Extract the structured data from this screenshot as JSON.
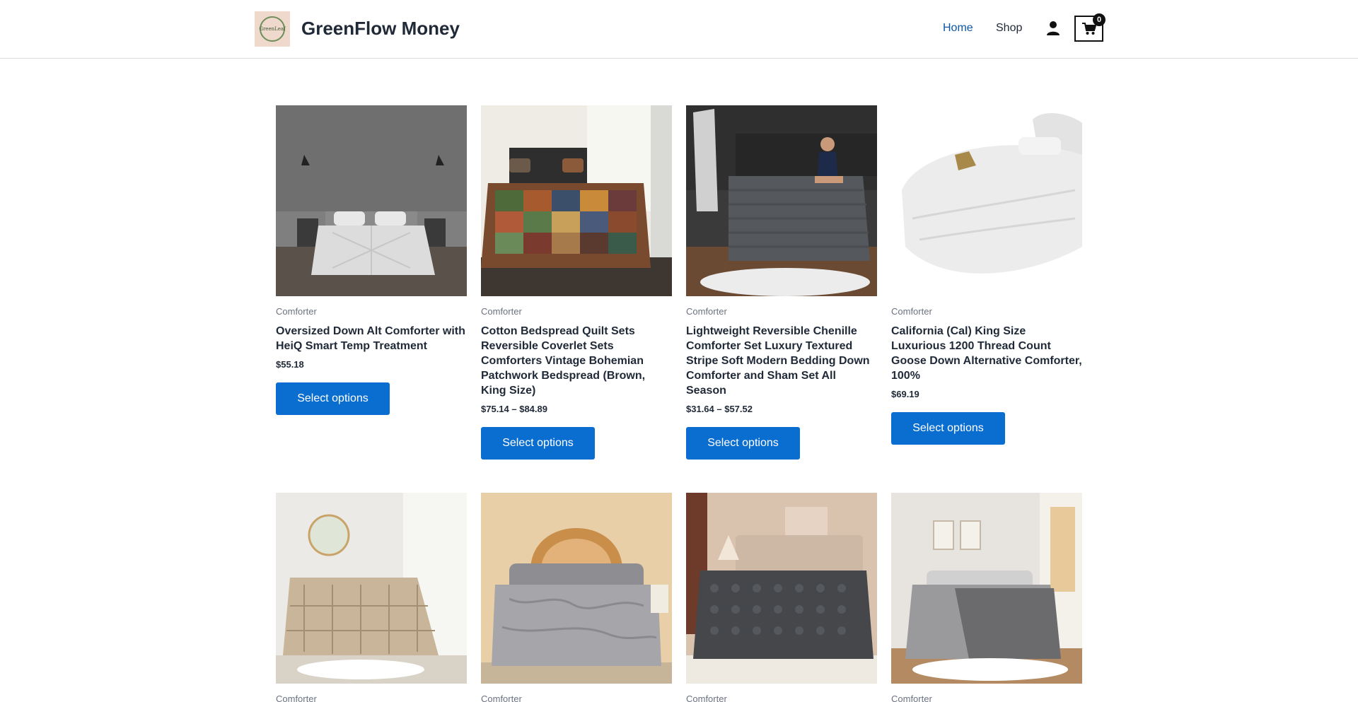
{
  "header": {
    "logo_text": "GreenLeaf",
    "site_title": "GreenFlow Money",
    "nav": {
      "home": "Home",
      "shop": "Shop"
    },
    "cart_count": "0",
    "accent_color": "#0a6ed1",
    "active_nav_color": "#0b57a8"
  },
  "products": [
    {
      "category": "Comforter",
      "title": "Oversized Down Alt Comforter with HeiQ Smart Temp Treatment",
      "price": "$55.18",
      "button": "Select options"
    },
    {
      "category": "Comforter",
      "title": "Cotton Bedspread Quilt Sets Reversible Coverlet Sets Comforters Vintage Bohemian Patchwork Bedspread (Brown, King Size)",
      "price": "$75.14 – $84.89",
      "button": "Select options"
    },
    {
      "category": "Comforter",
      "title": "Lightweight Reversible Chenille Comforter Set Luxury Textured Stripe Soft Modern Bedding Down Comforter and Sham Set All Season",
      "price": "$31.64 – $57.52",
      "button": "Select options"
    },
    {
      "category": "Comforter",
      "title": "California (Cal) King Size Luxurious 1200 Thread Count Goose Down Alternative Comforter, 100%",
      "price": "$69.19",
      "button": "Select options"
    },
    {
      "category": "Comforter"
    },
    {
      "category": "Comforter"
    },
    {
      "category": "Comforter"
    },
    {
      "category": "Comforter"
    }
  ]
}
